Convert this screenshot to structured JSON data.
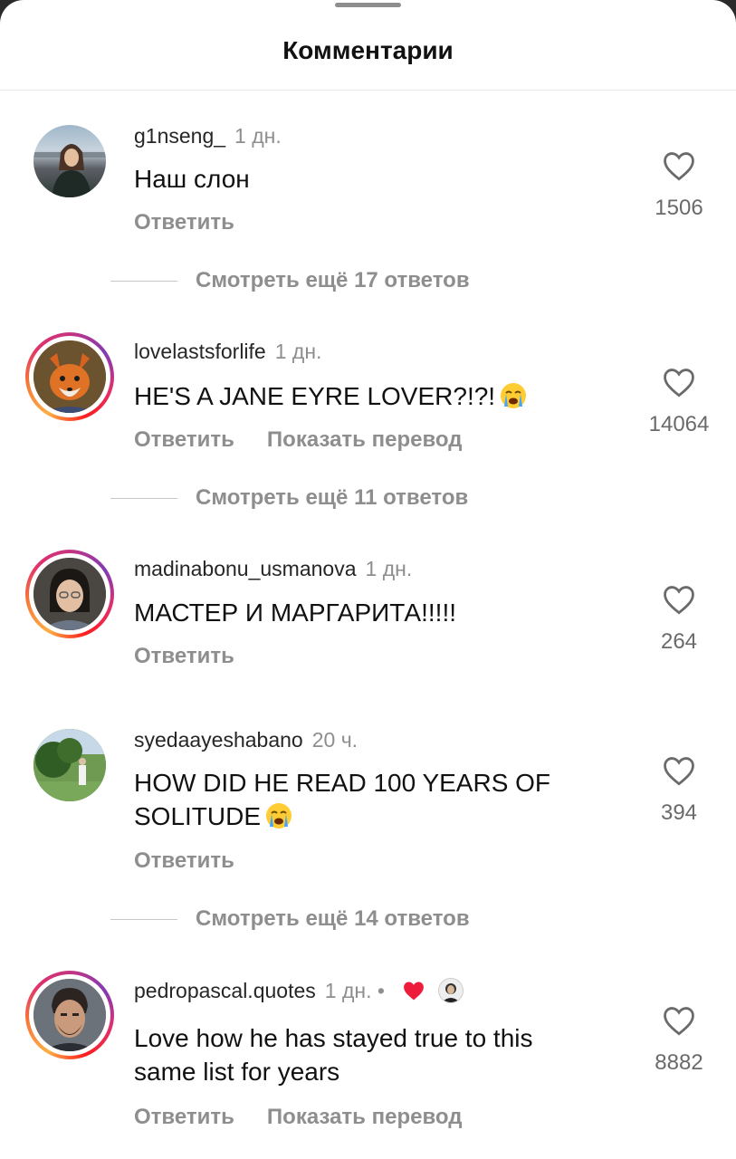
{
  "header": {
    "title": "Комментарии"
  },
  "colors": {
    "text": "#111111",
    "muted": "#8e8e8e",
    "like_heart": "#ed4956"
  },
  "comments": [
    {
      "username": "g1nseng_",
      "time": "1 дн.",
      "text": "Наш слон",
      "reply_label": "Ответить",
      "likes": "1506",
      "view_replies": "Смотреть ещё 17 ответов"
    },
    {
      "username": "lovelastsforlife",
      "time": "1 дн.",
      "text": "HE'S A JANE EYRE LOVER?!?!",
      "emoji": "crying-face",
      "reply_label": "Ответить",
      "translate_label": "Показать перевод",
      "likes": "14064",
      "view_replies": "Смотреть ещё 11 ответов"
    },
    {
      "username": "madinabonu_usmanova",
      "time": "1 дн.",
      "text": "МАСТЕР И МАРГАРИТА!!!!!",
      "reply_label": "Ответить",
      "likes": "264"
    },
    {
      "username": "syedaayeshabano",
      "time": "20 ч.",
      "text_line1": "HOW DID HE READ 100 YEARS OF",
      "text_line2": "SOLITUDE",
      "emoji": "crying-face",
      "reply_label": "Ответить",
      "likes": "394",
      "view_replies": "Смотреть ещё 14 ответов"
    },
    {
      "username": "pedropascal.quotes",
      "time": "1 дн. •",
      "creator_liked": true,
      "text_line1": "Love how he has stayed true to this",
      "text_line2": "same list for years",
      "reply_label": "Ответить",
      "translate_label": "Показать перевод",
      "likes": "8882"
    }
  ]
}
